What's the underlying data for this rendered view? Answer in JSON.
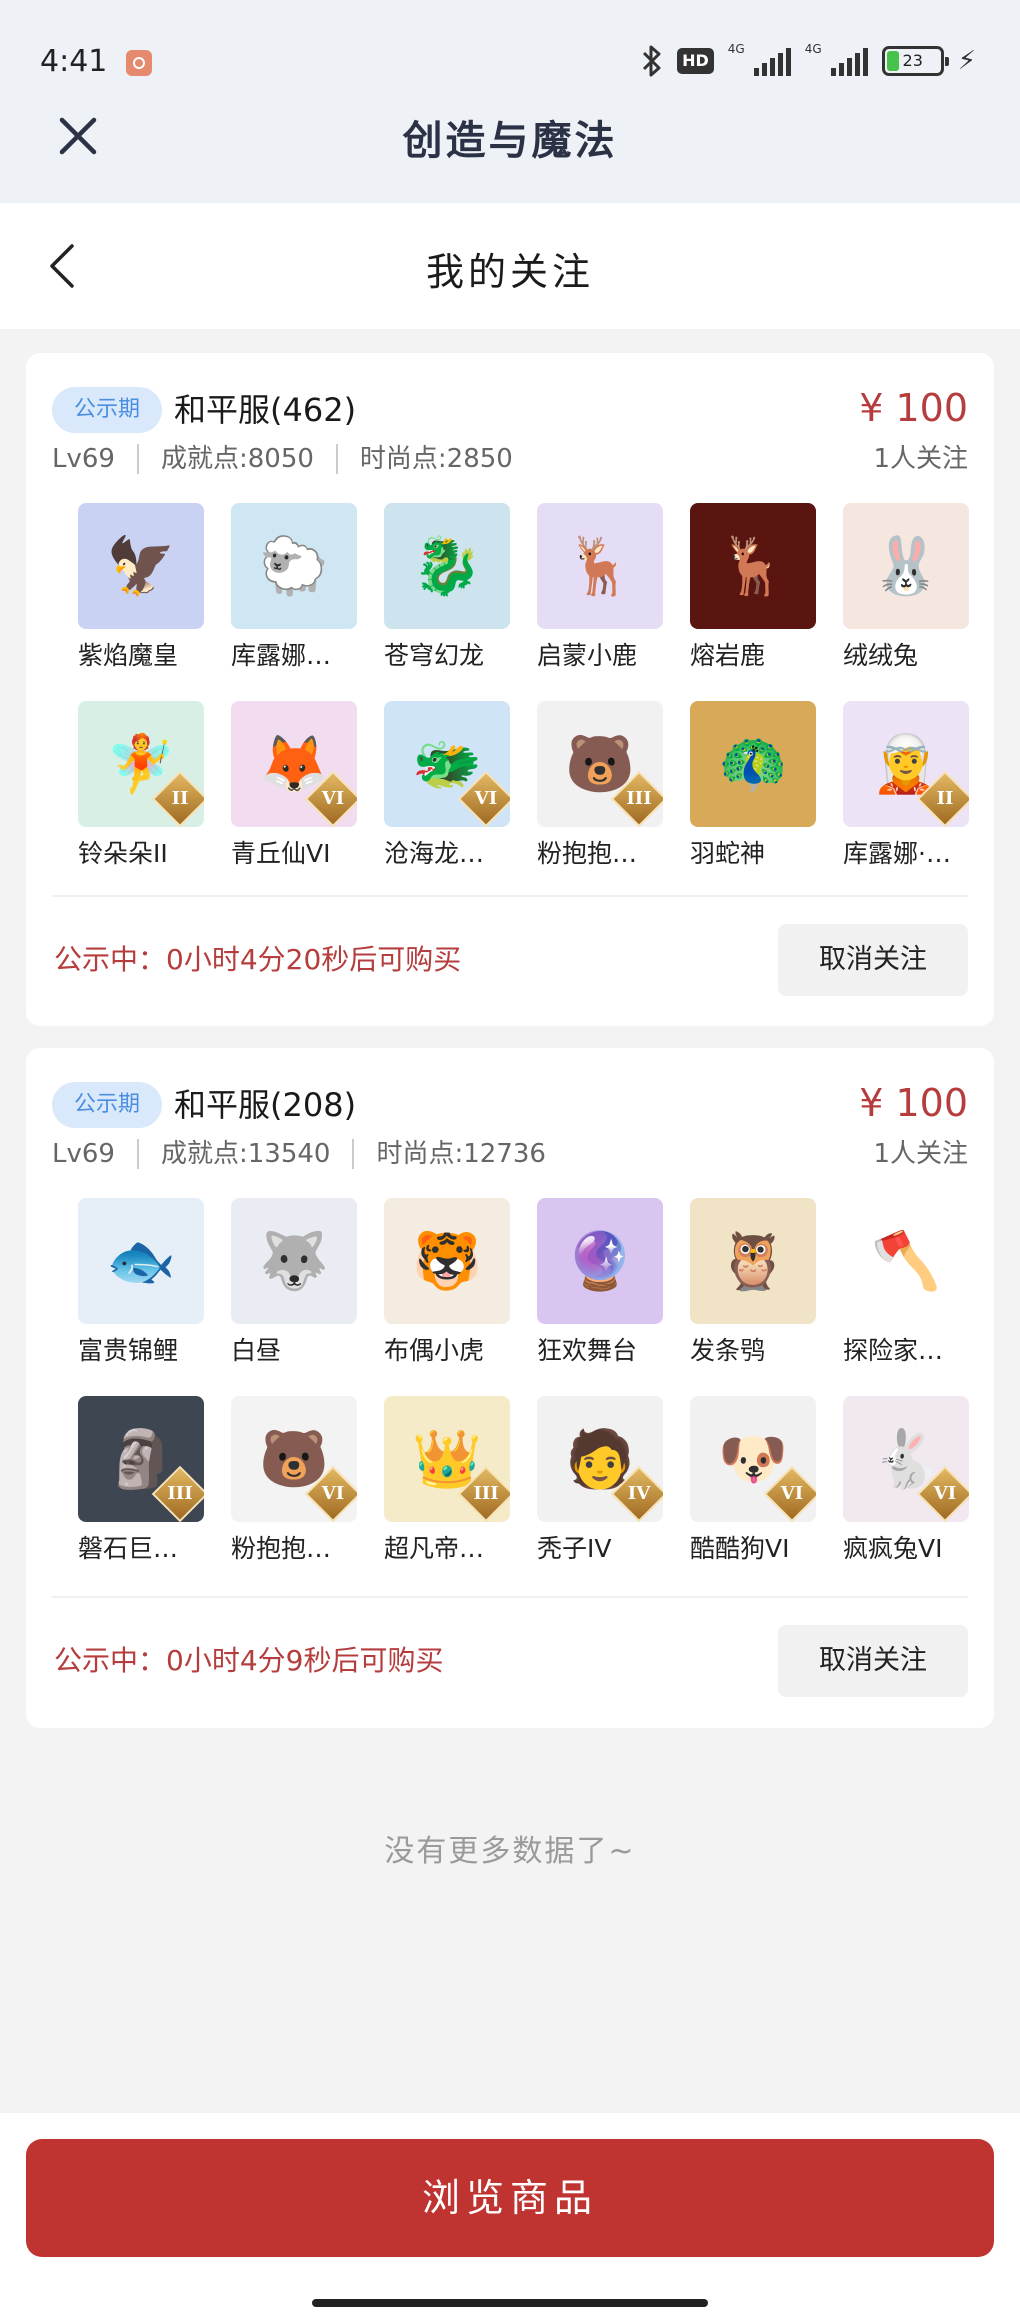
{
  "status_bar": {
    "time": "4:41",
    "hd_label": "HD",
    "signal_label_1": "4G",
    "signal_label_2": "4G",
    "battery_level": "23",
    "battery_fraction": 0.23
  },
  "header": {
    "title": "创造与魔法",
    "close_icon": "close-icon"
  },
  "subheader": {
    "title": "我的关注",
    "back_icon": "chevron-left-icon"
  },
  "listings": [
    {
      "badge": "公示期",
      "server": "和平服(462)",
      "price": "¥ 100",
      "level": "Lv69",
      "achievement": "成就点:8050",
      "fashion": "时尚点:2850",
      "followers": "1人关注",
      "items": [
        {
          "name": "紫焰魔皇",
          "glyph": "🦅",
          "bg": "#c9d2f3",
          "tier": ""
        },
        {
          "name": "库露娜…",
          "glyph": "🐑",
          "bg": "#cfe6f3",
          "tier": ""
        },
        {
          "name": "苍穹幻龙",
          "glyph": "🐉",
          "bg": "#cde4ee",
          "tier": ""
        },
        {
          "name": "启蒙小鹿",
          "glyph": "🦌",
          "bg": "#e5dcf5",
          "tier": ""
        },
        {
          "name": "熔岩鹿",
          "glyph": "🦌",
          "bg": "#5a1510",
          "tier": ""
        },
        {
          "name": "绒绒兔",
          "glyph": "🐰",
          "bg": "#f5e6df",
          "tier": ""
        },
        {
          "name": "铃朵朵II",
          "glyph": "🧚",
          "bg": "#d7efe4",
          "tier": "II"
        },
        {
          "name": "青丘仙VI",
          "glyph": "🦊",
          "bg": "#f2dcef",
          "tier": "VI"
        },
        {
          "name": "沧海龙…",
          "glyph": "🐲",
          "bg": "#cfe4f7",
          "tier": "VI"
        },
        {
          "name": "粉抱抱…",
          "glyph": "🐻",
          "bg": "#f1f1f1",
          "tier": "III"
        },
        {
          "name": "羽蛇神",
          "glyph": "🦚",
          "bg": "#d9a95a",
          "tier": ""
        },
        {
          "name": "库露娜·…",
          "glyph": "🧝",
          "bg": "#ece3f6",
          "tier": "II"
        }
      ],
      "countdown": "公示中：0小时4分20秒后可购买",
      "unfollow_label": "取消关注"
    },
    {
      "badge": "公示期",
      "server": "和平服(208)",
      "price": "¥ 100",
      "level": "Lv69",
      "achievement": "成就点:13540",
      "fashion": "时尚点:12736",
      "followers": "1人关注",
      "items": [
        {
          "name": "富贵锦鲤",
          "glyph": "🐟",
          "bg": "#e6eef7",
          "tier": ""
        },
        {
          "name": "白昼",
          "glyph": "🐺",
          "bg": "#e9edf3",
          "tier": ""
        },
        {
          "name": "布偶小虎",
          "glyph": "🐯",
          "bg": "#f4ece1",
          "tier": ""
        },
        {
          "name": "狂欢舞台",
          "glyph": "🔮",
          "bg": "#d8c6f0",
          "tier": ""
        },
        {
          "name": "发条鸮",
          "glyph": "🦉",
          "bg": "#f1e3c6",
          "tier": ""
        },
        {
          "name": "探险家…",
          "glyph": "🪓",
          "bg": "#ffffff",
          "tier": ""
        },
        {
          "name": "磐石巨…",
          "glyph": "🗿",
          "bg": "#3e4652",
          "tier": "III"
        },
        {
          "name": "粉抱抱…",
          "glyph": "🐻",
          "bg": "#f3f3f3",
          "tier": "VI"
        },
        {
          "name": "超凡帝…",
          "glyph": "👑",
          "bg": "#f6ebc9",
          "tier": "III"
        },
        {
          "name": "秃子IV",
          "glyph": "🧑",
          "bg": "#f1f1f1",
          "tier": "IV"
        },
        {
          "name": "酷酷狗VI",
          "glyph": "🐶",
          "bg": "#f1f1f1",
          "tier": "VI"
        },
        {
          "name": "疯疯兔VI",
          "glyph": "🐇",
          "bg": "#f2e8ef",
          "tier": "VI"
        }
      ],
      "countdown": "公示中：0小时4分9秒后可购买",
      "unfollow_label": "取消关注"
    }
  ],
  "footer_note": "没有更多数据了~",
  "bottom": {
    "browse_label": "浏览商品",
    "accent_color": "#bf3330"
  }
}
